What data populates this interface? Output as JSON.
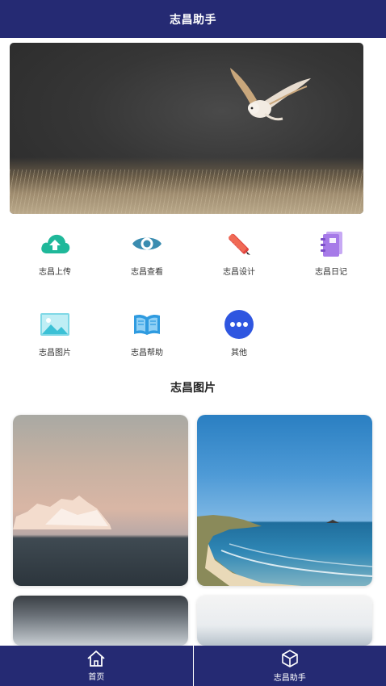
{
  "header": {
    "title": "志昌助手"
  },
  "menu": {
    "items": [
      {
        "label": "志昌上传",
        "icon": "upload-cloud-icon",
        "color": "#1fb89a"
      },
      {
        "label": "志昌查看",
        "icon": "eye-icon",
        "color": "#3a8cb0"
      },
      {
        "label": "志昌设计",
        "icon": "design-tools-icon",
        "color": "#e0433f"
      },
      {
        "label": "志昌日记",
        "icon": "notebook-icon",
        "color": "#a67ae8"
      },
      {
        "label": "志昌图片",
        "icon": "picture-icon",
        "color": "#3cc1d6"
      },
      {
        "label": "志昌帮助",
        "icon": "book-icon",
        "color": "#2f9be0"
      },
      {
        "label": "其他",
        "icon": "more-icon",
        "color": "#2f56e0"
      }
    ]
  },
  "gallery": {
    "title": "志昌图片"
  },
  "tabbar": {
    "tabs": [
      {
        "label": "首页",
        "icon": "home-icon"
      },
      {
        "label": "志昌助手",
        "icon": "cube-icon"
      }
    ]
  },
  "colors": {
    "primary": "#252a73"
  }
}
